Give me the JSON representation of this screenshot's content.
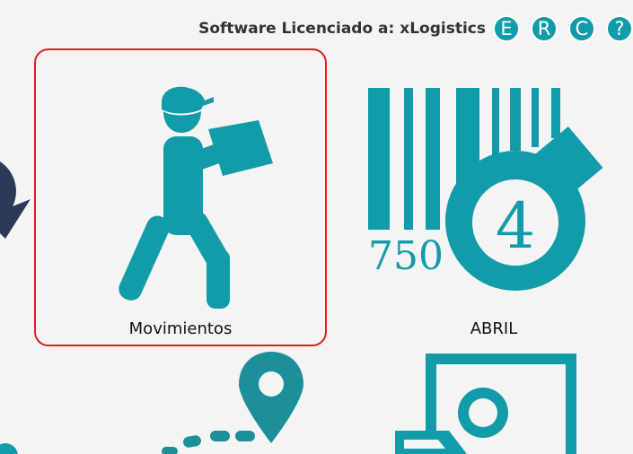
{
  "header": {
    "license_text": "Software Licenciado a: xLogistics",
    "buttons": [
      "E",
      "R",
      "C",
      "?"
    ]
  },
  "tiles": [
    {
      "label": "Movimientos",
      "icon": "delivery-person-icon",
      "selected": true
    },
    {
      "label": "ABRIL",
      "icon": "barcode-tag-icon",
      "barcode_number": "750",
      "tag_number": "4"
    },
    {
      "label": "",
      "icon": "route-pin-icon"
    },
    {
      "label": "",
      "icon": "document-icon"
    }
  ],
  "colors": {
    "accent": "#129ba8",
    "selection_border": "#e0201f",
    "background": "#f4f4f4",
    "dark_partial_icon": "#2b3a55"
  }
}
